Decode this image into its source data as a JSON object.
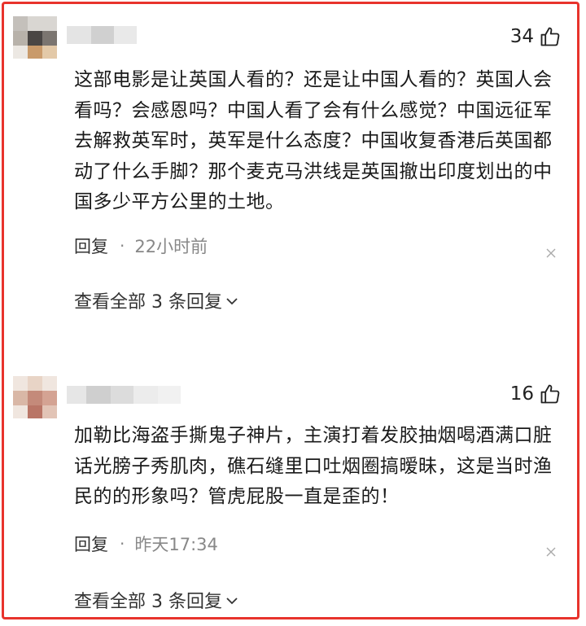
{
  "comments": [
    {
      "likes": "34",
      "text": "这部电影是让英国人看的？还是让中国人看的？英国人会看吗？会感恩吗？中国人看了会有什么感觉？中国远征军去解救英军时，英军是什么态度？中国收复香港后英国都动了什么手脚？那个麦克马洪线是英国撤出印度划出的中国多少平方公里的土地。",
      "reply_label": "回复",
      "separator": "·",
      "time": "22小时前",
      "view_replies": "查看全部 3 条回复"
    },
    {
      "likes": "16",
      "text": "加勒比海盗手撕鬼子神片，主演打着发胶抽烟喝酒满口脏话光膀子秀肌肉，礁石缝里口吐烟圈搞暧昧，这是当时渔民的的形象吗？管虎屁股一直是歪的！",
      "reply_label": "回复",
      "separator": "·",
      "time": "昨天17:34",
      "view_replies": "查看全部 3 条回复"
    }
  ],
  "colors": {
    "frame": "#e8332c",
    "meta_text": "#888888"
  },
  "icons": [
    "thumbs-up-icon",
    "close-icon",
    "chevron-down-icon"
  ]
}
